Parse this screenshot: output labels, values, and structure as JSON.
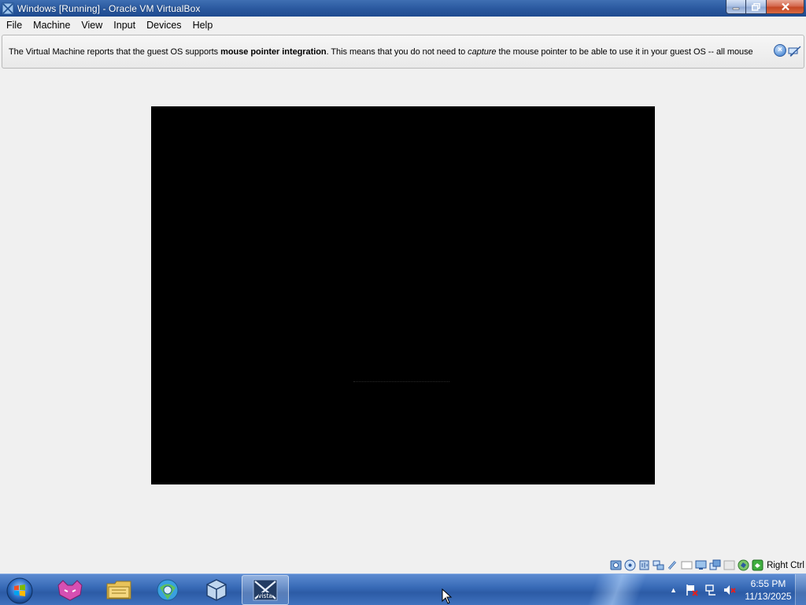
{
  "window": {
    "title": "Windows [Running] - Oracle VM VirtualBox",
    "controls": {
      "minimize": "minimize-icon",
      "maximize": "restore-icon",
      "close": "close-icon"
    }
  },
  "menu": {
    "items": [
      {
        "label": "File"
      },
      {
        "label": "Machine"
      },
      {
        "label": "View"
      },
      {
        "label": "Input"
      },
      {
        "label": "Devices"
      },
      {
        "label": "Help"
      }
    ]
  },
  "banner": {
    "text_1": "The Virtual Machine reports that the guest OS supports ",
    "bold_1": "mouse pointer integration",
    "text_2": ". This means that you do not need to ",
    "italic_1": "capture",
    "text_3": " the mouse pointer to be able to use it in your guest OS -- all mouse",
    "icons": [
      "close-banner-icon",
      "mute-notifications-icon"
    ]
  },
  "vm": {
    "screen_color": "#000000",
    "state": "Running"
  },
  "statusbar": {
    "icons": [
      "hard-disk-icon",
      "optical-drive-icon",
      "audio-icon",
      "network-icon",
      "usb-icon",
      "shared-folders-icon",
      "display-icon",
      "video-capture-icon",
      "recording-icon",
      "mouse-integration-icon",
      "keyboard-capture-icon"
    ],
    "host_key": "Right Ctrl"
  },
  "taskbar": {
    "start": "windows-start-orb",
    "pinned": [
      "cat-app-icon",
      "file-explorer-icon",
      "browser-icon",
      "virtualbox-icon",
      "vista-vm-icon"
    ],
    "active_label": "vista",
    "tray": {
      "chevron": "▲",
      "icons": [
        "action-center-icon",
        "network-tray-icon",
        "volume-muted-icon"
      ]
    },
    "clock": {
      "time": "6:55 PM",
      "date": "11/13/2025"
    }
  },
  "colors": {
    "titlebar": "#2b5aa0",
    "taskbar": "#3a6cb8",
    "window_bg": "#f0f0f0",
    "vm_screen": "#000000"
  }
}
